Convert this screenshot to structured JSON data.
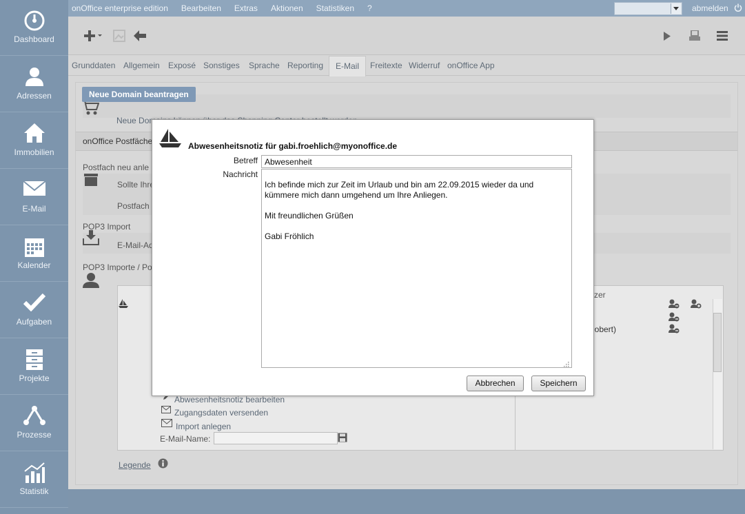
{
  "sidebar": {
    "items": [
      {
        "label": "Dashboard",
        "icon": "dashboard-icon"
      },
      {
        "label": "Adressen",
        "icon": "person-icon"
      },
      {
        "label": "Immobilien",
        "icon": "house-icon"
      },
      {
        "label": "E-Mail",
        "icon": "envelope-icon"
      },
      {
        "label": "Kalender",
        "icon": "calendar-icon"
      },
      {
        "label": "Aufgaben",
        "icon": "checkmark-icon"
      },
      {
        "label": "Projekte",
        "icon": "cabinet-icon"
      },
      {
        "label": "Prozesse",
        "icon": "process-icon"
      },
      {
        "label": "Statistik",
        "icon": "chart-icon"
      }
    ]
  },
  "topmenu": {
    "items": [
      "onOffice enterprise edition",
      "Bearbeiten",
      "Extras",
      "Aktionen",
      "Statistiken",
      "?"
    ],
    "logout": "abmelden"
  },
  "tabs": [
    "Grunddaten",
    "Allgemein",
    "Exposé",
    "Sonstiges",
    "Sprache",
    "Reporting",
    "E-Mail",
    "Freitexte",
    "Widerruf",
    "onOffice App"
  ],
  "active_tab": "E-Mail",
  "background": {
    "domain_button": "Neue Domain beantragen",
    "domain_text": "Neue Domains können über das Shopping Center bestellt werden.",
    "postfach_header": "onOffice Postfäche",
    "postfach_neu": "Postfach neu anle",
    "sollte": "Sollte Ihre",
    "postfach": "Postfach",
    "pop3_import": "POP3 Import",
    "email_ad": "E-Mail-Ad",
    "pop3_importe": "POP3 Importe / Po",
    "benutzer_header": "utzer",
    "benutzer_row1": ")",
    "benutzer_row2": "(Robert)",
    "abwesenheit_link": "Abwesenheitsnotiz bearbeiten",
    "zugang_link": "Zugangsdaten versenden",
    "import_link": "Import anlegen",
    "email_name_label": "E-Mail-Name:",
    "legende": "Legende"
  },
  "dialog": {
    "title": "Abwesenheitsnotiz für gabi.froehlich@myonoffice.de",
    "betreff_label": "Betreff",
    "betreff_value": "Abwesenheit",
    "nachricht_label": "Nachricht",
    "nachricht_value": "Ich befinde mich zur Zeit im Urlaub und bin am 22.09.2015 wieder da und kümmere mich dann umgehend um Ihre Anliegen.\n\nMit freundlichen Grüßen\n\nGabi Fröhlich",
    "cancel": "Abbrechen",
    "save": "Speichern"
  },
  "colors": {
    "sidebar": "#7d95ad",
    "accent_button": "#7f99b6",
    "link": "#5a6775"
  }
}
